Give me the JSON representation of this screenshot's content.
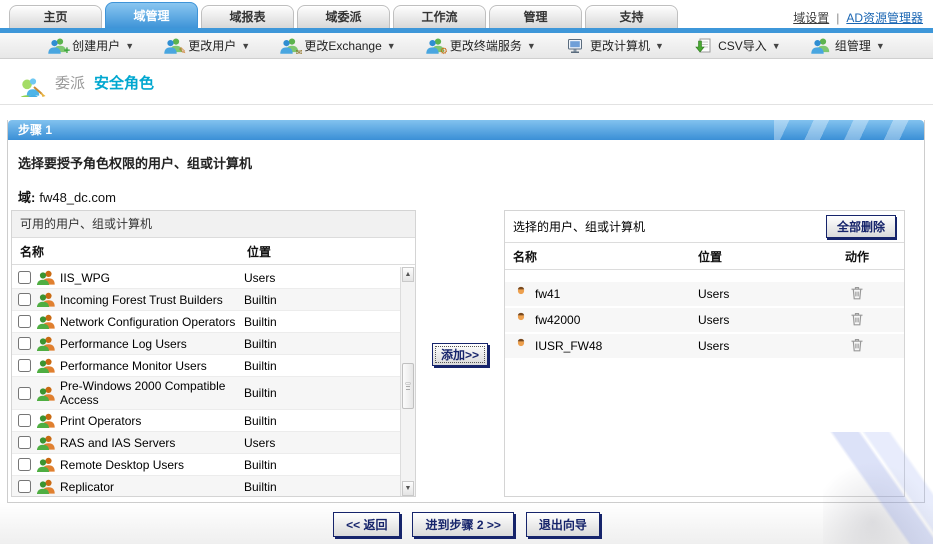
{
  "colors": {
    "accent": "#3e97d9",
    "navy": "#16246b",
    "title_cyan": "#00a7d0",
    "active_tab": "#3e94d8"
  },
  "tabs": {
    "items": [
      {
        "label": "主页",
        "active": false
      },
      {
        "label": "域管理",
        "active": true
      },
      {
        "label": "域报表",
        "active": false
      },
      {
        "label": "域委派",
        "active": false
      },
      {
        "label": "工作流",
        "active": false
      },
      {
        "label": "管理",
        "active": false
      },
      {
        "label": "支持",
        "active": false
      }
    ]
  },
  "header_links": {
    "domain_settings": "域设置",
    "separator": "|",
    "ad_explorer": "AD资源管理器"
  },
  "toolbar": {
    "items": [
      {
        "label": "创建用户",
        "icon": "user-add"
      },
      {
        "label": "更改用户",
        "icon": "user-edit"
      },
      {
        "label": "更改Exchange",
        "icon": "user-exchange"
      },
      {
        "label": "更改终端服务",
        "icon": "user-terminal"
      },
      {
        "label": "更改计算机",
        "icon": "computer"
      },
      {
        "label": "CSV导入",
        "icon": "csv"
      },
      {
        "label": "组管理",
        "icon": "group"
      }
    ]
  },
  "page": {
    "title_prefix": "委派",
    "title": "安全角色"
  },
  "wizard": {
    "step_label": "步骤 1",
    "instruction": "选择要授予角色权限的用户、组或计算机",
    "domain_label": "域:",
    "domain_value": "fw48_dc.com"
  },
  "available": {
    "title": "可用的用户、组或计算机",
    "columns": [
      "名称",
      "位置"
    ],
    "rows": [
      {
        "name": "IIS_WPG",
        "location": "Users"
      },
      {
        "name": "Incoming Forest Trust Builders",
        "location": "Builtin"
      },
      {
        "name": "Network Configuration Operators",
        "location": "Builtin"
      },
      {
        "name": "Performance Log Users",
        "location": "Builtin"
      },
      {
        "name": "Performance Monitor Users",
        "location": "Builtin"
      },
      {
        "name": "Pre-Windows 2000 Compatible Access",
        "location": "Builtin"
      },
      {
        "name": "Print Operators",
        "location": "Builtin"
      },
      {
        "name": "RAS and IAS Servers",
        "location": "Users"
      },
      {
        "name": "Remote Desktop Users",
        "location": "Builtin"
      },
      {
        "name": "Replicator",
        "location": "Builtin"
      }
    ]
  },
  "add_button_label": "添加>>",
  "selected": {
    "title": "选择的用户、组或计算机",
    "delete_all_label": "全部删除",
    "columns": [
      "名称",
      "位置",
      "动作"
    ],
    "rows": [
      {
        "name": "fw41",
        "location": "Users"
      },
      {
        "name": "fw42000",
        "location": "Users"
      },
      {
        "name": "IUSR_FW48",
        "location": "Users"
      }
    ]
  },
  "footer_buttons": {
    "back": "<< 返回",
    "next": "进到步骤 2 >>",
    "exit": "退出向导"
  }
}
